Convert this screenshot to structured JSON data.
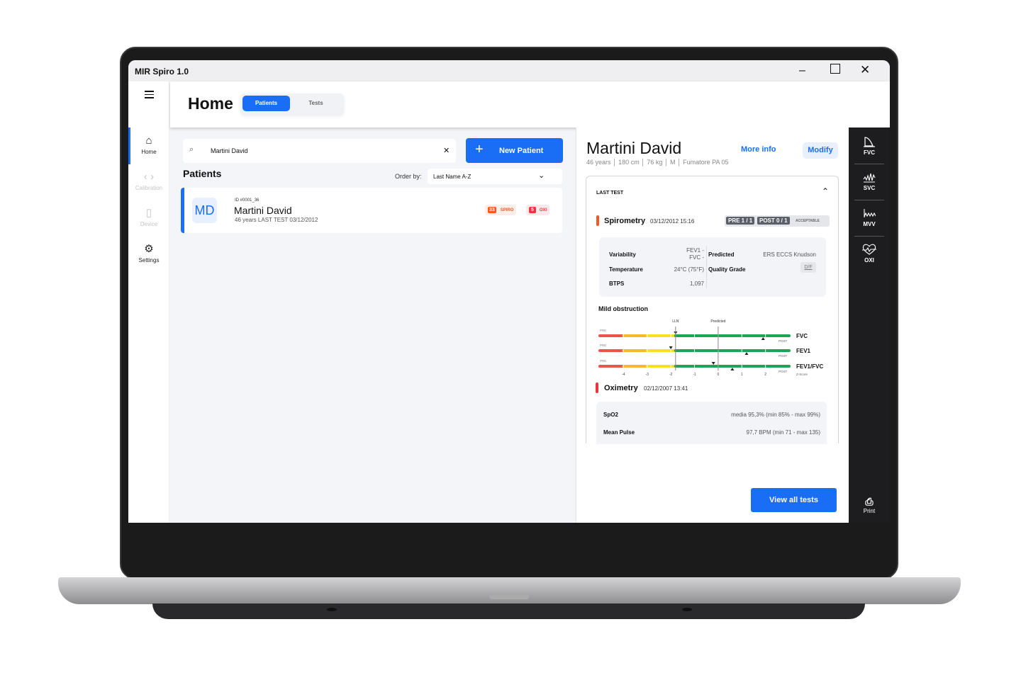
{
  "window": {
    "title": "MIR Spiro 1.0",
    "minimize": "–",
    "maximize": "☐",
    "close": "✕"
  },
  "nav": {
    "menu_icon": "hamburger-icon",
    "items": [
      {
        "label": "Home",
        "icon": "home-icon",
        "active": true
      },
      {
        "label": "Calibration",
        "icon": "code-icon",
        "disabled": true
      },
      {
        "label": "Device",
        "icon": "device-icon",
        "disabled": true
      },
      {
        "label": "Settings",
        "icon": "gear-icon"
      }
    ]
  },
  "header": {
    "title": "Home",
    "tabs": [
      {
        "label": "Patients",
        "active": true
      },
      {
        "label": "Tests"
      }
    ]
  },
  "search": {
    "value": "Martini David",
    "clear": "✕"
  },
  "new_patient": {
    "label": "New Patient",
    "icon": "+"
  },
  "patients": {
    "title": "Patients",
    "order_label": "Order by:",
    "order_value": "Last Name A-Z",
    "list": [
      {
        "initials": "MD",
        "id": "ID #0001_36",
        "name": "Martini David",
        "sub": "46 years LAST TEST 03/12/2012",
        "badges": [
          {
            "count": "33",
            "label": "SPIRO",
            "color": "#f15a24"
          },
          {
            "count": "5",
            "label": "OXI",
            "color": "#ef3340"
          }
        ]
      }
    ]
  },
  "detail": {
    "name": "Martini David",
    "meta": [
      "46 years",
      "180 cm",
      "76 kg",
      "M",
      "Fumatore PA 05"
    ],
    "more_info": "More info",
    "modify": "Modify",
    "last_test": "LAST TEST",
    "spirometry": {
      "title": "Spirometry",
      "date": "03/12/2012 15:16",
      "pre": "PRE 1 / 1",
      "post": "POST 0 / 1",
      "status": "ACCEPTABLE",
      "rows": [
        {
          "label": "Variability",
          "value1": "FEV1 -",
          "value2": "FVC -"
        },
        {
          "label": "Temperature",
          "value": "24°C (75°F)"
        },
        {
          "label": "BTPS",
          "value": "1,097"
        }
      ],
      "predicted_label": "Predicted",
      "predicted_value": "ERS ECCS Knudson",
      "quality_label": "Quality Grade",
      "quality_value": "D/F"
    },
    "interpretation": "Mild obstruction",
    "oximetry": {
      "title": "Oximetry",
      "date": "02/12/2007 13:41",
      "rows": [
        {
          "label": "SpO2",
          "value": "media 95,3% (min 85% - max 99%)"
        },
        {
          "label": "Mean Pulse",
          "value": "97,7 BPM (min 71 - max 135)"
        }
      ]
    },
    "view_all": "View all tests"
  },
  "tests_bar": {
    "items": [
      {
        "label": "FVC",
        "icon": "fvc-curve-icon"
      },
      {
        "label": "SVC",
        "icon": "svc-wave-icon"
      },
      {
        "label": "MVV",
        "icon": "mvv-wave-icon"
      },
      {
        "label": "OXI",
        "icon": "heart-pulse-icon"
      }
    ],
    "print": "Print"
  },
  "chart_data": {
    "type": "zscore-bullet",
    "xlim": [
      -5,
      3
    ],
    "ticks": [
      "-4",
      "-3",
      "-2",
      "-1",
      "0",
      "1",
      "2"
    ],
    "tick_values": [
      -4,
      -3,
      -2,
      -1,
      0,
      1,
      2
    ],
    "xlabel": "Z-Score",
    "lln_label": "LLN",
    "lln": -1.8,
    "predicted_label": "Predicted",
    "predicted": 0,
    "pre_label": "PRE",
    "post_label": "POST",
    "zones": [
      {
        "from": -5,
        "to": -4,
        "color": "#e8544e"
      },
      {
        "from": -4,
        "to": -3,
        "color": "#f7b731"
      },
      {
        "from": -3,
        "to": -1.8,
        "color": "#f5e11e"
      },
      {
        "from": -1.8,
        "to": 3,
        "color": "#1aa655"
      }
    ],
    "series": [
      {
        "name": "FVC",
        "pre": -1.8,
        "post": 1.9
      },
      {
        "name": "FEV1",
        "pre": -2.0,
        "post": 1.2
      },
      {
        "name": "FEV1/FVC",
        "pre": -0.2,
        "post": 0.6
      }
    ]
  }
}
